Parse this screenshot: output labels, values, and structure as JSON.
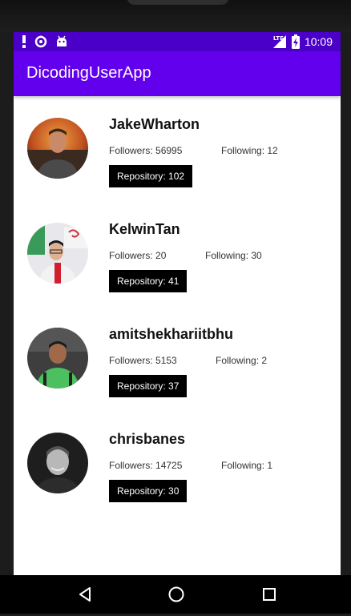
{
  "status_bar": {
    "time": "10:09",
    "network": "LTE",
    "left_icons": [
      "alert-icon",
      "data-saver-icon",
      "android-icon"
    ],
    "background": "#4a00c8"
  },
  "app_bar": {
    "title": "DicodingUserApp",
    "background": "#6200ee"
  },
  "users": [
    {
      "username": "JakeWharton",
      "followers": "Followers: 56995",
      "following": "Following: 12",
      "repository": "Repository: 102"
    },
    {
      "username": "KelwinTan",
      "followers": "Followers: 20",
      "following": "Following: 30",
      "repository": "Repository: 41"
    },
    {
      "username": "amitshekhariitbhu",
      "followers": "Followers: 5153",
      "following": "Following: 2",
      "repository": "Repository: 37"
    },
    {
      "username": "chrisbanes",
      "followers": "Followers: 14725",
      "following": "Following: 1",
      "repository": "Repository: 30"
    }
  ],
  "nav_bar": {
    "buttons": [
      "back-icon",
      "home-icon",
      "recents-icon"
    ]
  }
}
